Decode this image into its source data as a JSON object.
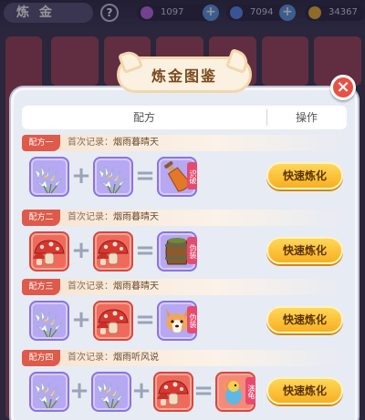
{
  "top_bar": {
    "title": "炼 金",
    "help": "?",
    "resources": [
      {
        "value": "1097",
        "icon": "gem-icon",
        "color": "#c06ae8"
      },
      {
        "value": "7094",
        "icon": "crystal-icon",
        "color": "#5a8bf0"
      },
      {
        "value": "34367",
        "icon": "coin-icon",
        "color": "#f0b432"
      }
    ],
    "plus": "+"
  },
  "modal": {
    "title": "炼金图鉴",
    "close": "×",
    "header": {
      "col_recipe": "配方",
      "col_action": "操作"
    },
    "record_prefix": "首次记录：",
    "recipes": [
      {
        "tag": "配方一",
        "record": "烟雨暮晴天",
        "result_badge": "识破",
        "button": "快速炼化"
      },
      {
        "tag": "配方二",
        "record": "烟雨暮晴天",
        "result_badge": "伪装",
        "button": "快速炼化"
      },
      {
        "tag": "配方三",
        "record": "烟雨暮晴天",
        "result_badge": "伪装",
        "button": "快速炼化"
      },
      {
        "tag": "配方四",
        "record": "烟雨听风说",
        "result_badge": "演龟",
        "button": "快速炼化"
      }
    ]
  },
  "colors": {
    "accent_button": "#f7b021",
    "tag_red": "#de5a4a",
    "slot_purple": "#b6a8f2",
    "slot_red": "#f06a5c"
  }
}
